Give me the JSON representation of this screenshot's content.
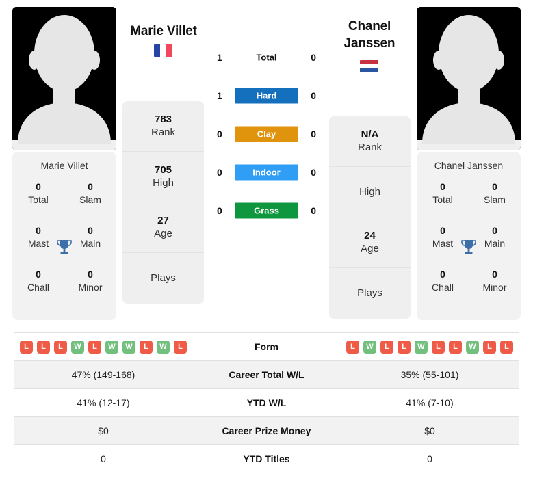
{
  "players": {
    "left": {
      "name": "Marie Villet",
      "flag_name": "france-flag",
      "flag_colors": [
        "#2643a5",
        "#ffffff",
        "#f1485c"
      ],
      "card_name": "Marie Villet",
      "rank": "783",
      "rank_label": "Rank",
      "high": "705",
      "high_label": "High",
      "age": "27",
      "age_label": "Age",
      "plays": "",
      "plays_label": "Plays",
      "titles": {
        "total": "0",
        "total_label": "Total",
        "slam": "0",
        "slam_label": "Slam",
        "mast": "0",
        "mast_label": "Mast",
        "main": "0",
        "main_label": "Main",
        "chall": "0",
        "chall_label": "Chall",
        "minor": "0",
        "minor_label": "Minor"
      },
      "form": [
        "L",
        "L",
        "L",
        "W",
        "L",
        "W",
        "W",
        "L",
        "W",
        "L"
      ],
      "career_total_wl": "47% (149-168)",
      "ytd_wl": "41% (12-17)",
      "career_prize_money": "$0",
      "ytd_titles": "0"
    },
    "right": {
      "name": "Chanel Janssen",
      "flag_name": "netherlands-flag",
      "flag_colors": [
        "#c8313e",
        "#ffffff",
        "#2b55a3"
      ],
      "card_name": "Chanel Janssen",
      "rank": "N/A",
      "rank_label": "Rank",
      "high": "",
      "high_label": "High",
      "age": "24",
      "age_label": "Age",
      "plays": "",
      "plays_label": "Plays",
      "titles": {
        "total": "0",
        "total_label": "Total",
        "slam": "0",
        "slam_label": "Slam",
        "mast": "0",
        "mast_label": "Mast",
        "main": "0",
        "main_label": "Main",
        "chall": "0",
        "chall_label": "Chall",
        "minor": "0",
        "minor_label": "Minor"
      },
      "form": [
        "L",
        "W",
        "L",
        "L",
        "W",
        "L",
        "L",
        "W",
        "L",
        "L"
      ],
      "career_total_wl": "35% (55-101)",
      "ytd_wl": "41% (7-10)",
      "career_prize_money": "$0",
      "ytd_titles": "0"
    }
  },
  "surfaces": [
    {
      "label": "Total",
      "left_score": "1",
      "right_score": "0",
      "color": "transparent",
      "text_color": "#111111"
    },
    {
      "label": "Hard",
      "left_score": "1",
      "right_score": "0",
      "color": "#1470bd",
      "text_color": "#ffffff"
    },
    {
      "label": "Clay",
      "left_score": "0",
      "right_score": "0",
      "color": "#e0930c",
      "text_color": "#ffffff"
    },
    {
      "label": "Indoor",
      "left_score": "0",
      "right_score": "0",
      "color": "#2f9ef4",
      "text_color": "#ffffff"
    },
    {
      "label": "Grass",
      "left_score": "0",
      "right_score": "0",
      "color": "#0f9740",
      "text_color": "#ffffff"
    }
  ],
  "table": {
    "rows": [
      {
        "label": "Form",
        "type": "form",
        "key": "form"
      },
      {
        "label": "Career Total W/L",
        "type": "text",
        "key": "career_total_wl"
      },
      {
        "label": "YTD W/L",
        "type": "text",
        "key": "ytd_wl"
      },
      {
        "label": "Career Prize Money",
        "type": "text",
        "key": "career_prize_money"
      },
      {
        "label": "YTD Titles",
        "type": "text",
        "key": "ytd_titles"
      }
    ]
  },
  "colors": {
    "win_badge": "#73bf7e",
    "loss_badge": "#ef5b47",
    "trophy": "#3c6fa8",
    "card_bg": "#f2f2f2",
    "row_shade": "#f2f2f2"
  }
}
